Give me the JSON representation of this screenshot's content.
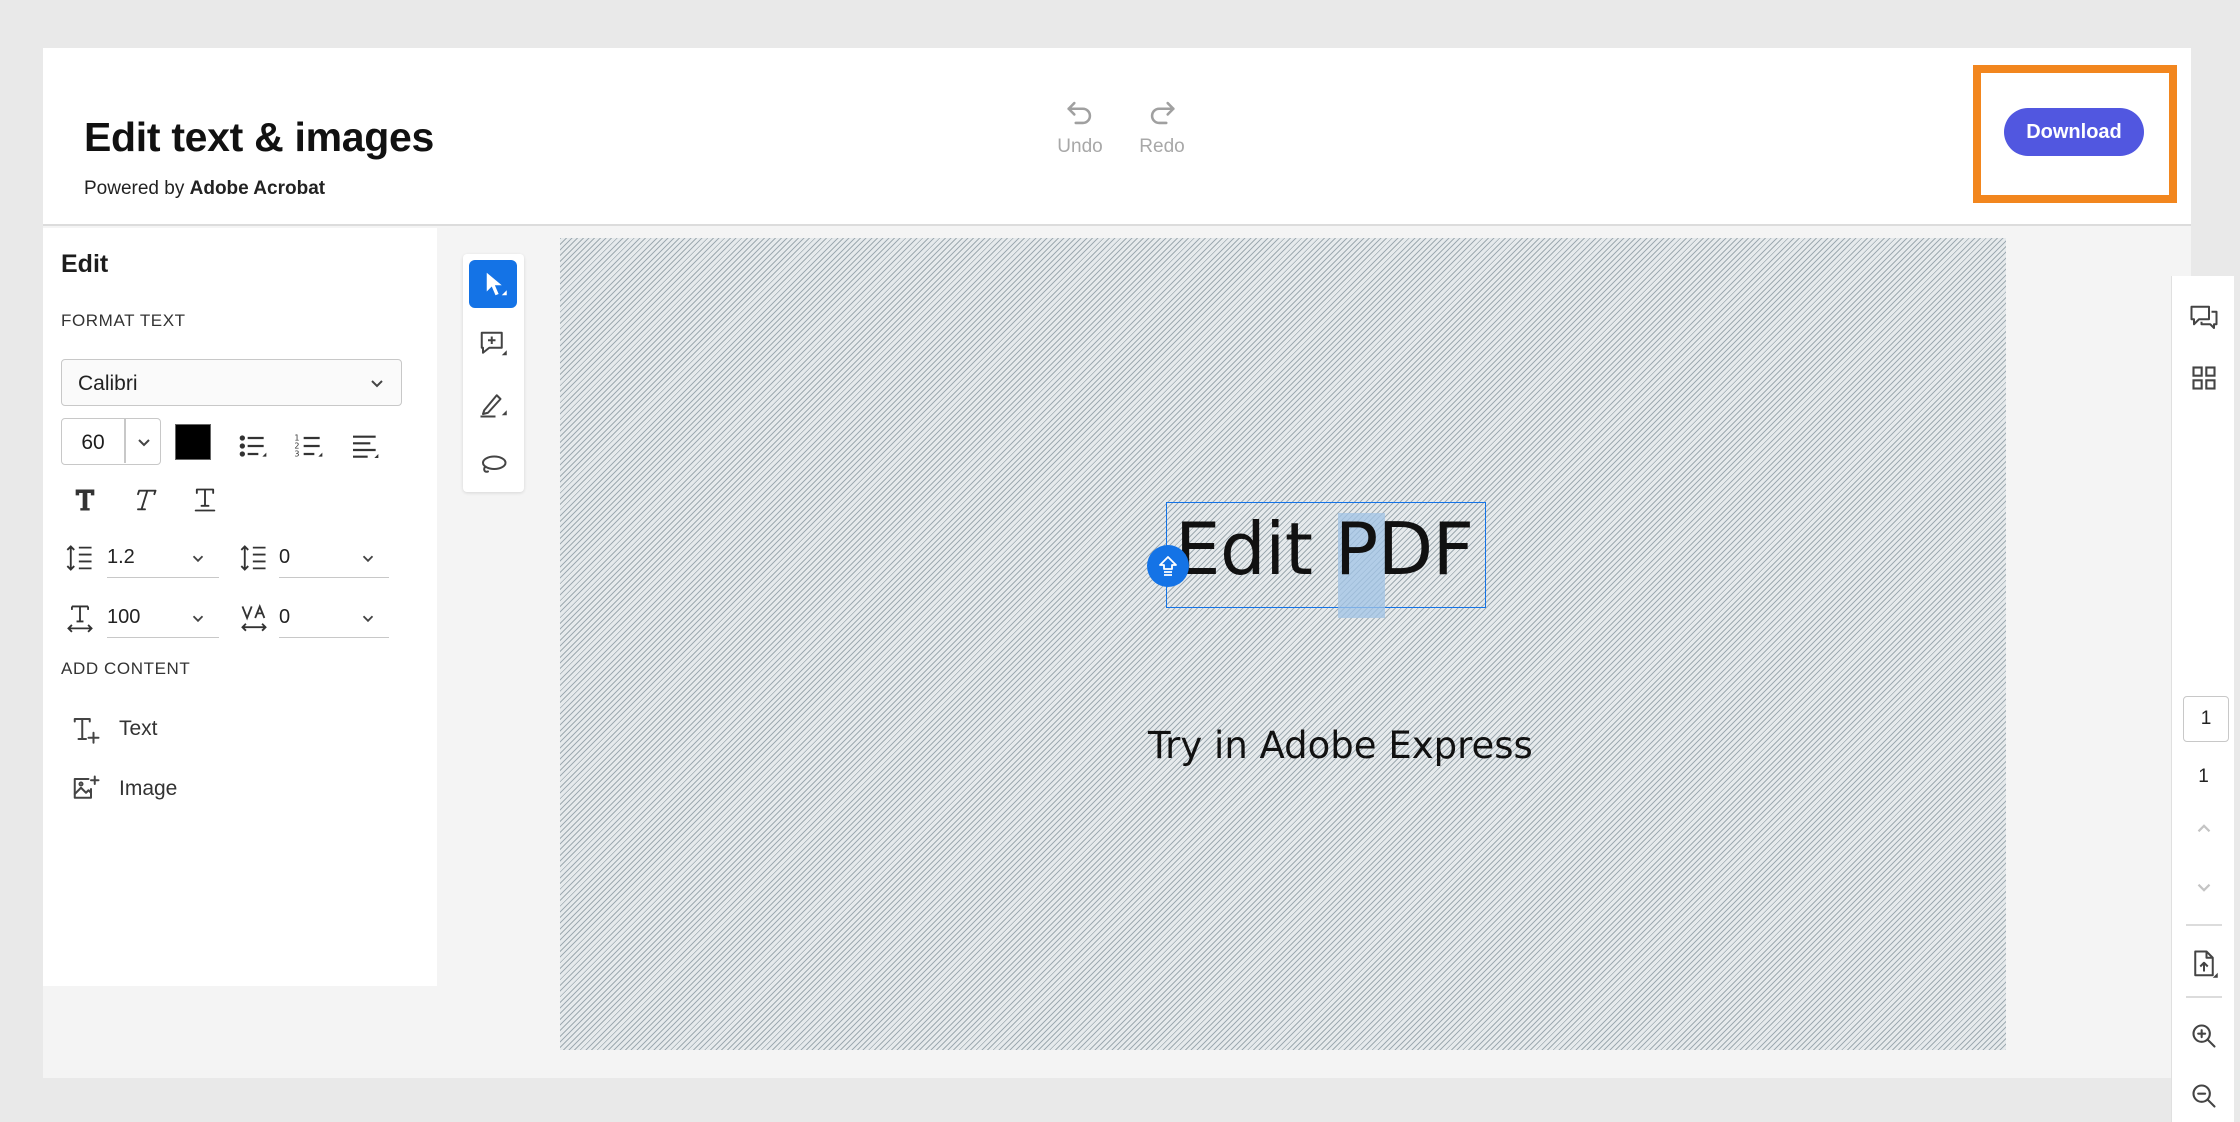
{
  "header": {
    "title": "Edit text & images",
    "powered_prefix": "Powered by",
    "powered_brand": "Adobe Acrobat",
    "undo_label": "Undo",
    "redo_label": "Redo",
    "download_label": "Download",
    "download_color": "#5157e0",
    "highlight_color": "#f2861e"
  },
  "left_panel": {
    "title": "Edit",
    "format_section": "FORMAT TEXT",
    "font_family": "Calibri",
    "font_size": "60",
    "text_color": "#000000",
    "line_spacing": "1.2",
    "paragraph_spacing": "0",
    "horizontal_scale": "100",
    "character_spacing": "0",
    "add_section": "ADD CONTENT",
    "add_text_label": "Text",
    "add_image_label": "Image"
  },
  "document": {
    "title_text": "Edit PDF",
    "subtitle_text": "Try in Adobe Express"
  },
  "right_rail": {
    "current_page": "1",
    "total_pages": "1"
  },
  "icons": {
    "undo": "undo-icon",
    "redo": "redo-icon",
    "select": "cursor-icon",
    "comment": "add-comment-icon",
    "draw": "pen-icon",
    "lasso": "lasso-icon",
    "comments_panel": "comments-icon",
    "thumbnails": "grid-icon",
    "page_tool": "page-icon",
    "zoom_in": "zoom-in-icon",
    "zoom_out": "zoom-out-icon"
  },
  "accent_color": "#1473e6"
}
